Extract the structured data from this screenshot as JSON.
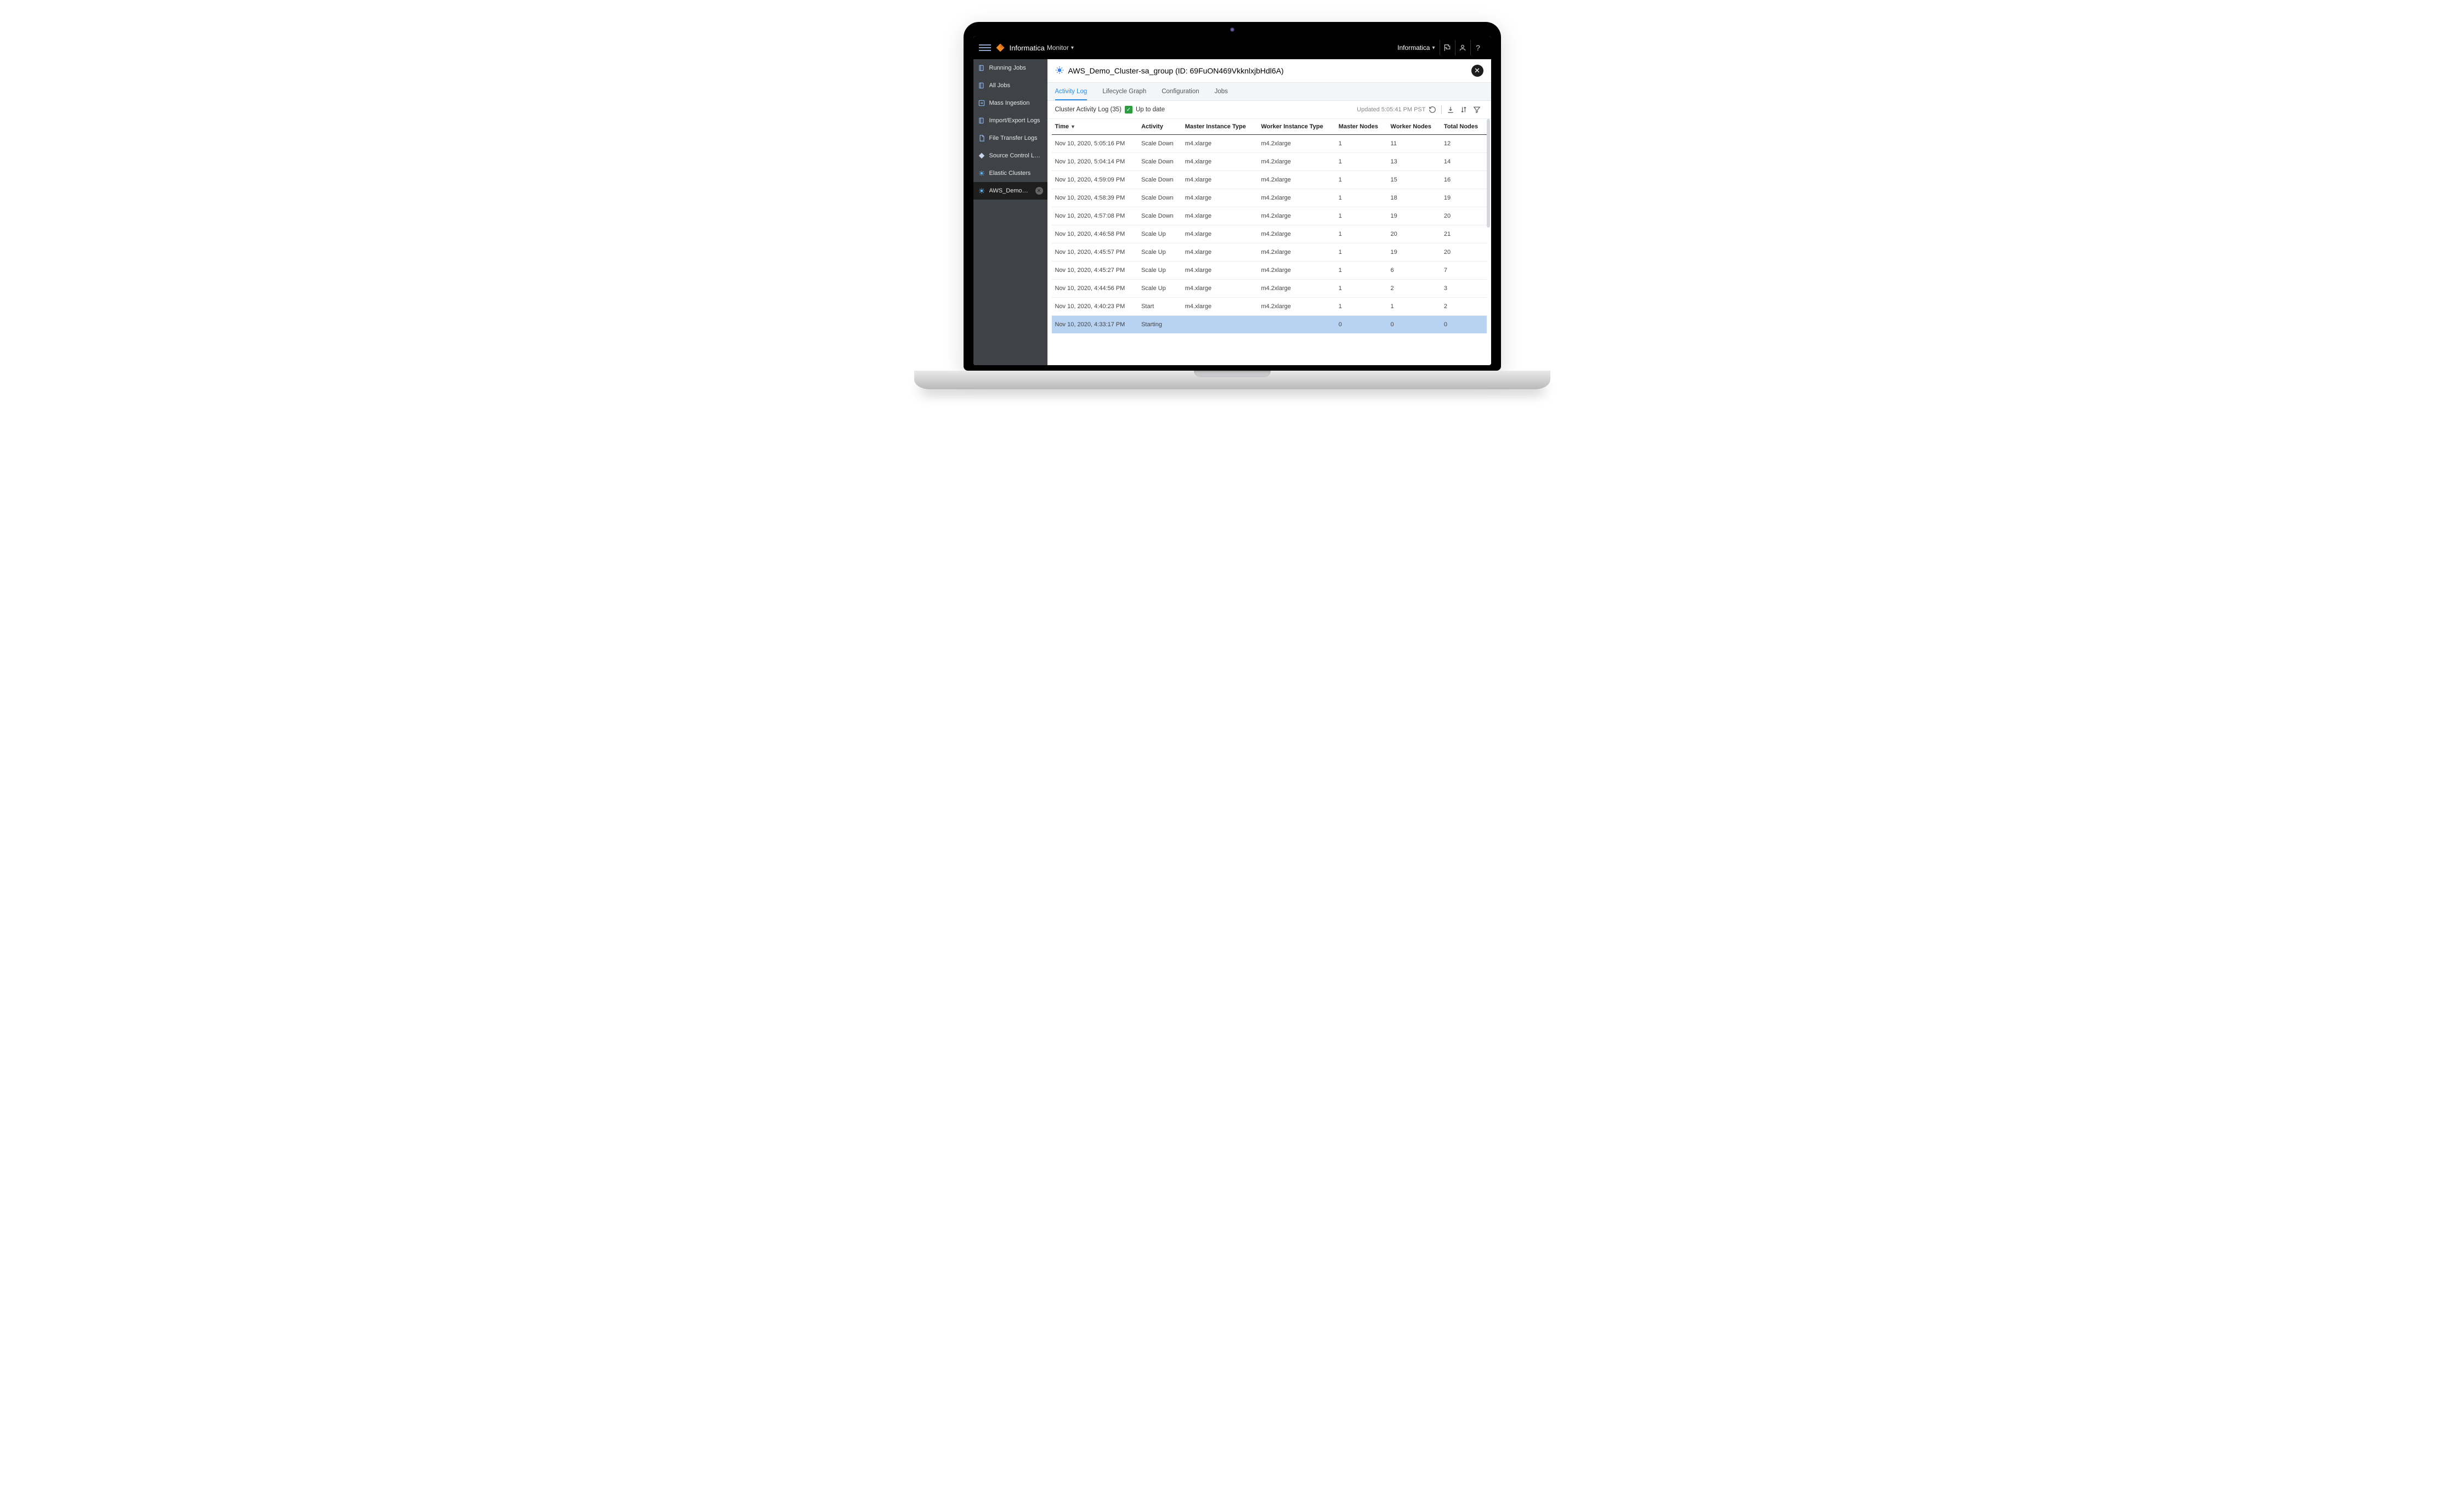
{
  "topbar": {
    "brand": "Informatica",
    "mode": "Monitor",
    "org": "Informatica"
  },
  "sidebar": {
    "items": [
      {
        "label": "Running Jobs",
        "icon": "stack-icon"
      },
      {
        "label": "All Jobs",
        "icon": "stack-icon"
      },
      {
        "label": "Mass Ingestion",
        "icon": "arrow-right-icon"
      },
      {
        "label": "Import/Export Logs",
        "icon": "stack-icon"
      },
      {
        "label": "File Transfer Logs",
        "icon": "file-icon"
      },
      {
        "label": "Source Control Logs",
        "icon": "diamond-icon"
      },
      {
        "label": "Elastic Clusters",
        "icon": "bug-icon"
      },
      {
        "label": "AWS_Demo_Cluste...",
        "icon": "bug-icon",
        "active": true,
        "closable": true
      }
    ]
  },
  "page": {
    "title": "AWS_Demo_Cluster-sa_group (ID: 69FuON469VkknlxjbHdl6A)"
  },
  "tabs": {
    "items": [
      {
        "label": "Activity Log",
        "active": true
      },
      {
        "label": "Lifecycle Graph"
      },
      {
        "label": "Configuration"
      },
      {
        "label": "Jobs"
      }
    ]
  },
  "toolbar": {
    "title": "Cluster Activity Log (35)",
    "status": "Up to date",
    "updated": "Updated 5:05:41 PM PST"
  },
  "table": {
    "columns": [
      "Time",
      "Activity",
      "Master Instance Type",
      "Worker Instance Type",
      "Master Nodes",
      "Worker Nodes",
      "Total Nodes"
    ],
    "sort_col": 0,
    "rows": [
      {
        "time": "Nov 10, 2020, 5:05:16 PM",
        "activity": "Scale Down",
        "mit": "m4.xlarge",
        "wit": "m4.2xlarge",
        "mn": "1",
        "wn": "11",
        "tn": "12"
      },
      {
        "time": "Nov 10, 2020, 5:04:14 PM",
        "activity": "Scale Down",
        "mit": "m4.xlarge",
        "wit": "m4.2xlarge",
        "mn": "1",
        "wn": "13",
        "tn": "14"
      },
      {
        "time": "Nov 10, 2020, 4:59:09 PM",
        "activity": "Scale Down",
        "mit": "m4.xlarge",
        "wit": "m4.2xlarge",
        "mn": "1",
        "wn": "15",
        "tn": "16"
      },
      {
        "time": "Nov 10, 2020, 4:58:39 PM",
        "activity": "Scale Down",
        "mit": "m4.xlarge",
        "wit": "m4.2xlarge",
        "mn": "1",
        "wn": "18",
        "tn": "19"
      },
      {
        "time": "Nov 10, 2020, 4:57:08 PM",
        "activity": "Scale Down",
        "mit": "m4.xlarge",
        "wit": "m4.2xlarge",
        "mn": "1",
        "wn": "19",
        "tn": "20"
      },
      {
        "time": "Nov 10, 2020, 4:46:58 PM",
        "activity": "Scale Up",
        "mit": "m4.xlarge",
        "wit": "m4.2xlarge",
        "mn": "1",
        "wn": "20",
        "tn": "21"
      },
      {
        "time": "Nov 10, 2020, 4:45:57 PM",
        "activity": "Scale Up",
        "mit": "m4.xlarge",
        "wit": "m4.2xlarge",
        "mn": "1",
        "wn": "19",
        "tn": "20"
      },
      {
        "time": "Nov 10, 2020, 4:45:27 PM",
        "activity": "Scale Up",
        "mit": "m4.xlarge",
        "wit": "m4.2xlarge",
        "mn": "1",
        "wn": "6",
        "tn": "7"
      },
      {
        "time": "Nov 10, 2020, 4:44:56 PM",
        "activity": "Scale Up",
        "mit": "m4.xlarge",
        "wit": "m4.2xlarge",
        "mn": "1",
        "wn": "2",
        "tn": "3"
      },
      {
        "time": "Nov 10, 2020, 4:40:23 PM",
        "activity": "Start",
        "mit": "m4.xlarge",
        "wit": "m4.2xlarge",
        "mn": "1",
        "wn": "1",
        "tn": "2"
      },
      {
        "time": "Nov 10, 2020, 4:33:17 PM",
        "activity": "Starting",
        "mit": "",
        "wit": "",
        "mn": "0",
        "wn": "0",
        "tn": "0",
        "highlight": true
      }
    ]
  }
}
